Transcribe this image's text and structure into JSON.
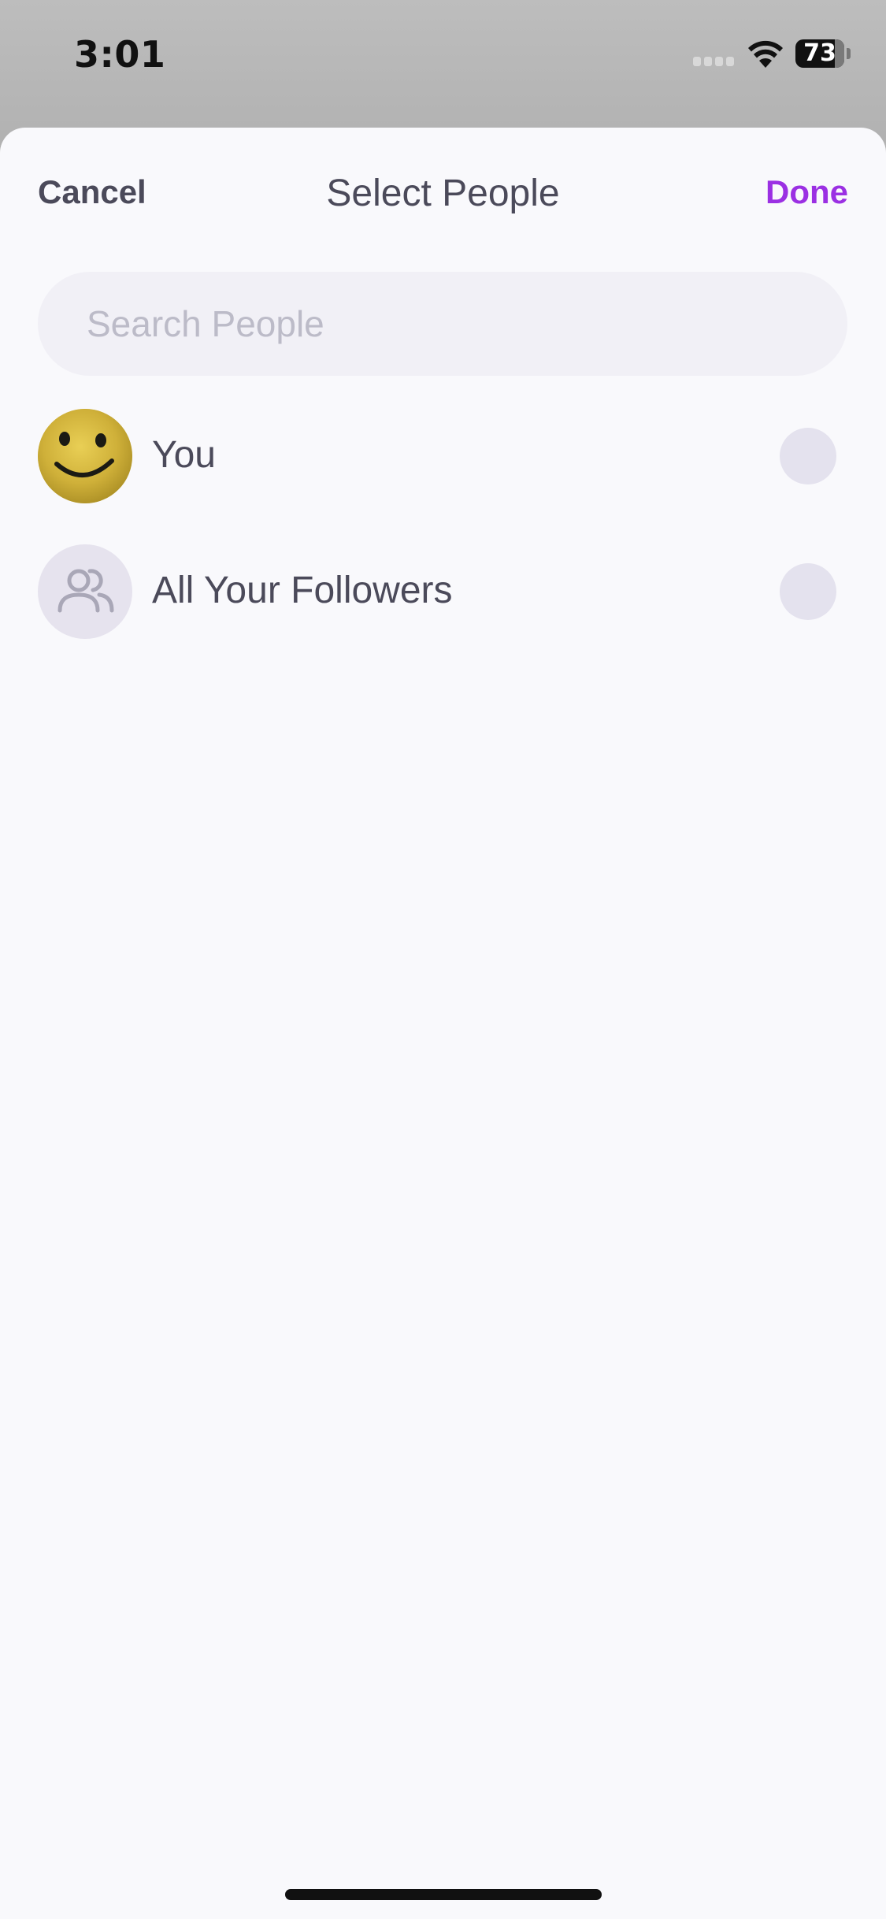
{
  "status_bar": {
    "time": "3:01",
    "battery": "73"
  },
  "sheet": {
    "cancel_label": "Cancel",
    "title": "Select People",
    "done_label": "Done",
    "search_placeholder": "Search People",
    "search_value": ""
  },
  "people": [
    {
      "name": "You",
      "avatar_icon": "smiley-face-avatar",
      "selected": false
    },
    {
      "name": "All Your Followers",
      "avatar_icon": "people-group-icon",
      "selected": false
    }
  ],
  "colors": {
    "accent": "#9b30e3",
    "text": "#4b4a5a",
    "placeholder": "#bcbbc8",
    "sheet_background": "#f9f9fc",
    "radio": "#e4e2ee"
  }
}
